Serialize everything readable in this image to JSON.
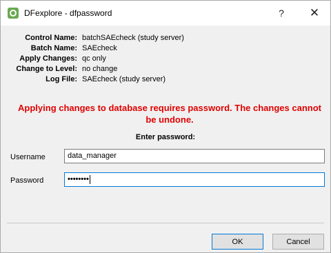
{
  "window": {
    "title": "DFexplore - dfpassword",
    "help_glyph": "?",
    "close_glyph": "✕"
  },
  "info": [
    {
      "label": "Control Name:",
      "value": "batchSAEcheck (study server)"
    },
    {
      "label": "Batch Name:",
      "value": "SAEcheck"
    },
    {
      "label": "Apply Changes:",
      "value": "qc only"
    },
    {
      "label": "Change to Level:",
      "value": "no change"
    },
    {
      "label": "Log File:",
      "value": "SAEcheck (study server)"
    }
  ],
  "warning": "Applying changes to database requires password. The changes cannot be undone.",
  "enter_password_label": "Enter password:",
  "username": {
    "label": "Username",
    "value": "data_manager"
  },
  "password": {
    "label": "Password",
    "masked_value": "••••••••"
  },
  "buttons": {
    "ok": "OK",
    "cancel": "Cancel"
  },
  "colors": {
    "warning": "#e00000",
    "focus": "#0078d7",
    "app_icon": "#6aa84f"
  }
}
